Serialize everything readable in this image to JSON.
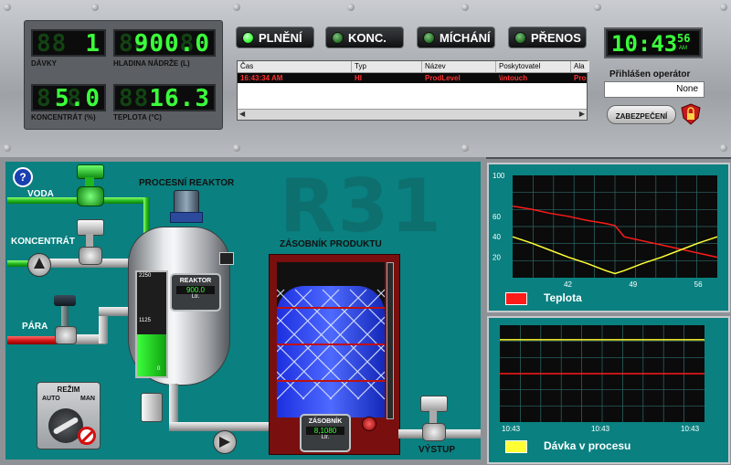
{
  "top_panel": {
    "displays": [
      {
        "id": "davky",
        "label": "DÁVKY",
        "value": "1"
      },
      {
        "id": "hladina",
        "label": "HLADINA NÁDRŽE (L)",
        "value": "900.0"
      },
      {
        "id": "koncentrat",
        "label": "KONCENTRÁT (%)",
        "value": "5.0"
      },
      {
        "id": "teplota",
        "label": "TEPLOTA (°C)",
        "value": "16.3"
      }
    ],
    "buttons": [
      {
        "label": "PLNĚNÍ",
        "led": "#3cff3c"
      },
      {
        "label": "KONC.",
        "led": "#2f7a2f"
      },
      {
        "label": "MÍCHÁNÍ",
        "led": "#2f7a2f"
      },
      {
        "label": "PŘENOS",
        "led": "#2f7a2f"
      }
    ],
    "alarm_table": {
      "columns": [
        "Čas",
        "Typ",
        "Název",
        "Poskytovatel",
        "Ala"
      ],
      "rows": [
        [
          "16:43:34 AM",
          "HI",
          "ProdLevel",
          "\\intouch",
          "Pro"
        ]
      ]
    },
    "clock": {
      "time": "10:43",
      "seconds": "56",
      "ampm": "AM"
    },
    "operator": {
      "title": "Přihlášen operátor",
      "value": "None"
    },
    "security_button": "ZABEZPEČENÍ"
  },
  "process": {
    "watermark": "R31",
    "help_icon": "?",
    "labels": {
      "voda": "VODA",
      "koncentrat": "KONCENTRÁT",
      "para": "PÁRA",
      "reaktor_title": "PROCESNÍ REAKTOR",
      "zasobnik_title": "ZÁSOBNÍK PRODUKTU",
      "vystup": "VÝSTUP"
    },
    "reactor": {
      "name": "REAKTOR",
      "value": "900.0",
      "unit": "Ltr.",
      "scale_top": "2250",
      "scale_mid": "1125",
      "scale_bottom": "0",
      "level_fraction": 0.4
    },
    "tank": {
      "name": "ZÁSOBNÍK",
      "value": "8,1080",
      "unit": "Ltr.",
      "level_fraction": 0.85
    },
    "mode_switch": {
      "title": "REŽIM",
      "left": "AUTO",
      "right": "MAN"
    }
  },
  "chart_data": [
    {
      "type": "line",
      "title": "",
      "x": [
        36,
        38,
        40,
        42,
        44,
        46,
        47,
        48,
        50,
        52,
        54,
        56,
        58
      ],
      "x_ticks": [
        "42",
        "49",
        "56"
      ],
      "y_ticks": [
        "20",
        "40",
        "60",
        "100"
      ],
      "ylim": [
        0,
        100
      ],
      "series": [
        {
          "name": "Teplota",
          "color": "#ff1a1a",
          "values": [
            70,
            67,
            63,
            60,
            56,
            53,
            51,
            40,
            36,
            32,
            28,
            24,
            20
          ]
        },
        {
          "name": "",
          "color": "#ffff33",
          "values": [
            40,
            34,
            27,
            20,
            14,
            7,
            4,
            7,
            14,
            20,
            27,
            34,
            40
          ]
        }
      ],
      "legend": {
        "label": "Teplota",
        "color": "#ff1a1a"
      }
    },
    {
      "type": "line",
      "title": "",
      "x_ticks": [
        "10:43",
        "10:43",
        "10:43"
      ],
      "series": [
        {
          "name": "Dávka v procesu",
          "color": "#ffff33",
          "values": [
            0.85,
            0.85
          ]
        },
        {
          "name": "",
          "color": "#ff1a1a",
          "values": [
            0.5,
            0.5
          ]
        }
      ],
      "legend": {
        "label": "Dávka v procesu",
        "color": "#ffff33"
      }
    }
  ]
}
